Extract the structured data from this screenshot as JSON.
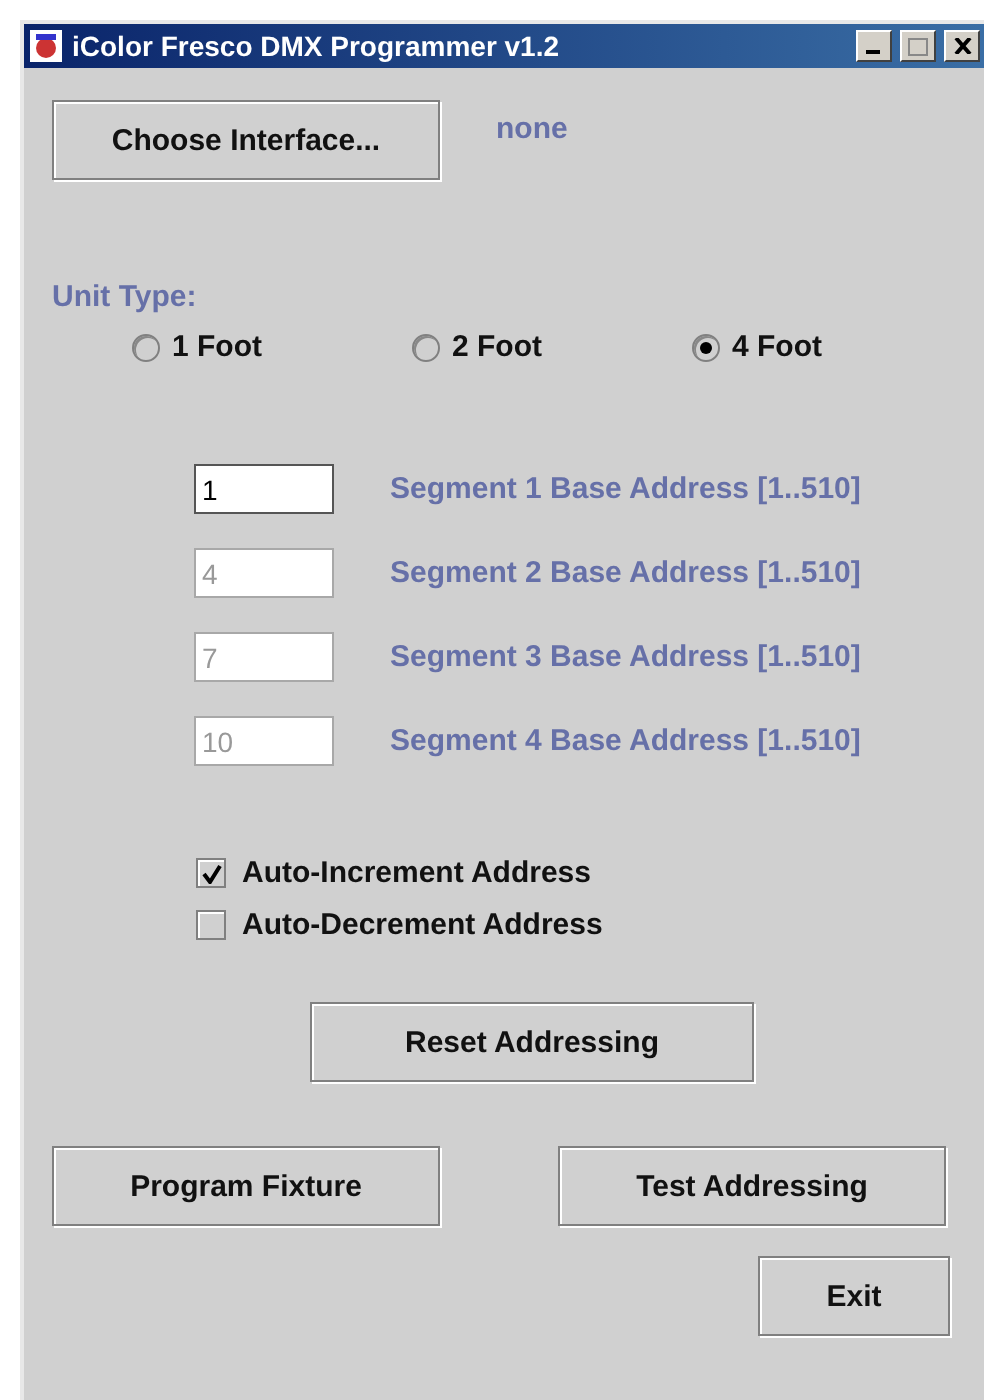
{
  "window": {
    "title": "iColor Fresco DMX Programmer v1.2"
  },
  "interface": {
    "button": "Choose Interface...",
    "status": "none"
  },
  "unit_type": {
    "label": "Unit Type:",
    "options": [
      {
        "label": "1 Foot",
        "selected": false
      },
      {
        "label": "2 Foot",
        "selected": false
      },
      {
        "label": "4 Foot",
        "selected": true
      }
    ]
  },
  "segments": [
    {
      "value": "1",
      "label": "Segment 1 Base Address [1..510]",
      "disabled": false
    },
    {
      "value": "4",
      "label": "Segment 2 Base Address [1..510]",
      "disabled": true
    },
    {
      "value": "7",
      "label": "Segment 3 Base Address [1..510]",
      "disabled": true
    },
    {
      "value": "10",
      "label": "Segment 4 Base Address [1..510]",
      "disabled": true
    }
  ],
  "options": [
    {
      "label": "Auto-Increment Address",
      "checked": true
    },
    {
      "label": "Auto-Decrement Address",
      "checked": false
    }
  ],
  "buttons": {
    "reset": "Reset Addressing",
    "program": "Program Fixture",
    "test": "Test Addressing",
    "exit": "Exit"
  }
}
